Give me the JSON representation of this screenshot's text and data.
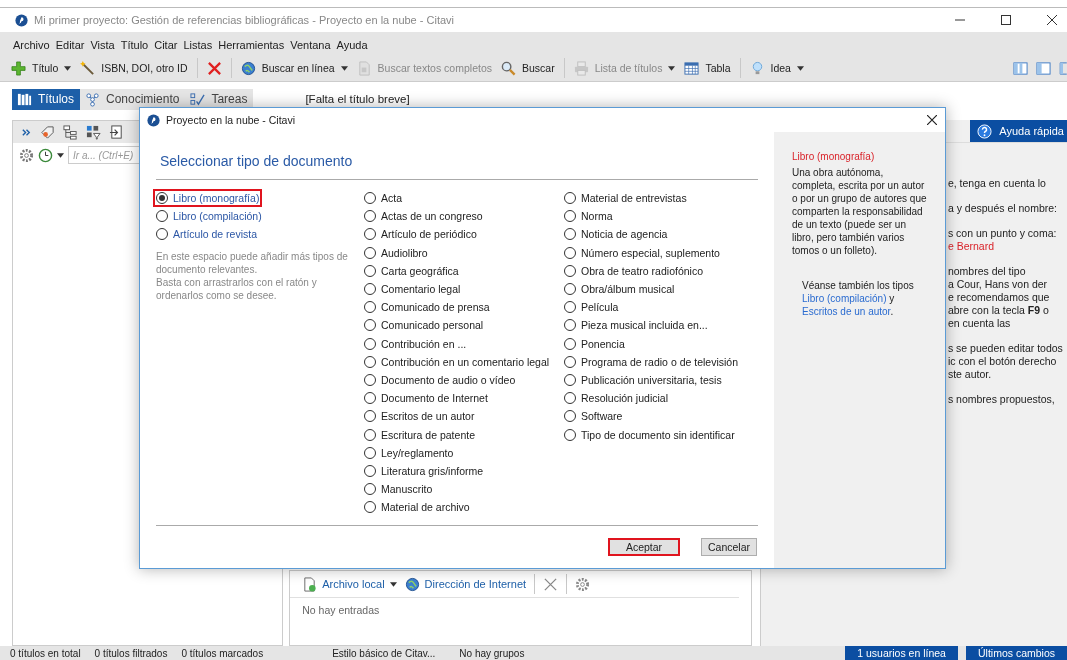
{
  "window": {
    "title": "Mi primer proyecto: Gestión de referencias bibliográficas - Proyecto en la nube - Citavi"
  },
  "menu": [
    "Archivo",
    "Editar",
    "Vista",
    "Título",
    "Citar",
    "Listas",
    "Herramientas",
    "Ventana",
    "Ayuda"
  ],
  "toolbar": [
    {
      "kind": "add",
      "label": "Título",
      "dropdown": true,
      "disabled": false
    },
    {
      "kind": "identifier",
      "label": "ISBN, DOI, otro ID",
      "dropdown": false,
      "disabled": false
    },
    {
      "kind": "separator"
    },
    {
      "kind": "delete",
      "dropdown": false,
      "disabled": false
    },
    {
      "kind": "separator"
    },
    {
      "kind": "online",
      "label": "Buscar en línea",
      "dropdown": true,
      "disabled": false
    },
    {
      "kind": "fulltext",
      "label": "Buscar textos completos",
      "dropdown": false,
      "disabled": true
    },
    {
      "kind": "search",
      "label": "Buscar",
      "dropdown": false,
      "disabled": false
    },
    {
      "kind": "separator"
    },
    {
      "kind": "print",
      "label": "Lista de títulos",
      "dropdown": true,
      "disabled": true
    },
    {
      "kind": "table",
      "label": "Tabla",
      "dropdown": false,
      "disabled": false
    },
    {
      "kind": "separator"
    },
    {
      "kind": "idea",
      "label": "Idea",
      "dropdown": true,
      "disabled": false
    }
  ],
  "tabs": [
    {
      "label": "Títulos",
      "selected": true
    },
    {
      "label": "Conocimiento",
      "selected": false
    },
    {
      "label": "Tareas",
      "selected": false
    }
  ],
  "short_title": "[Falta el título breve]",
  "left_panel": {
    "search": {
      "placeholder": "Ir a... (Ctrl+E)"
    }
  },
  "attachments": {
    "buttons": [
      {
        "label": "Archivo local",
        "dropdown": true
      },
      {
        "label": "Dirección de Internet",
        "dropdown": false
      }
    ],
    "empty": "No hay entradas"
  },
  "help_panel": {
    "button": "Ayuda rápida",
    "paragraphs": [
      [
        {
          "text": "e, tenga en cuenta lo",
          "kind": "text"
        }
      ],
      [
        {
          "text": "a y después el nombre:",
          "kind": "text"
        }
      ],
      [
        {
          "text": "s con un punto y coma:",
          "kind": "text"
        },
        {
          "text": "e Bernard",
          "kind": "name"
        }
      ],
      [
        {
          "text": "nombres del tipo",
          "kind": "text"
        },
        {
          "text": "a Cour, Hans von der",
          "kind": "text"
        },
        {
          "text": "e recomendamos que",
          "kind": "text"
        },
        {
          "text": "abre con la tecla **F9** o",
          "kind": "text"
        },
        {
          "text": "en cuenta las",
          "kind": "text"
        }
      ],
      [
        {
          "text": "s se pueden editar todos",
          "kind": "text"
        },
        {
          "text": "ic con el botón derecho",
          "kind": "text"
        },
        {
          "text": "ste autor.",
          "kind": "text"
        }
      ],
      [
        {
          "text": "s nombres propuestos,",
          "kind": "text"
        }
      ]
    ]
  },
  "dialog": {
    "title": "Proyecto en la nube - Citavi",
    "heading": "Seleccionar tipo de documento",
    "favorites": [
      {
        "label": "Libro (monografía)",
        "selected": true,
        "highlighted": true
      },
      {
        "label": "Libro (compilación)",
        "selected": false,
        "highlighted": false
      },
      {
        "label": "Artículo de revista",
        "selected": false,
        "highlighted": false
      }
    ],
    "hint": [
      "En este espacio puede añadir más tipos de documento relevantes.",
      "Basta con arrastrarlos con el ratón y ordenarlos como se desee."
    ],
    "columns": [
      [
        {
          "label": "Acta",
          "selected": false
        },
        {
          "label": "Actas de un congreso",
          "selected": false
        },
        {
          "label": "Artículo de periódico",
          "selected": false
        },
        {
          "label": "Audiolibro",
          "selected": false
        },
        {
          "label": "Carta geográfica",
          "selected": false
        },
        {
          "label": "Comentario legal",
          "selected": false
        },
        {
          "label": "Comunicado de prensa",
          "selected": false
        },
        {
          "label": "Comunicado personal",
          "selected": false
        },
        {
          "label": "Contribución en ...",
          "selected": false
        },
        {
          "label": "Contribución en un comentario legal",
          "selected": false
        },
        {
          "label": "Documento de audio o vídeo",
          "selected": false
        },
        {
          "label": "Documento de Internet",
          "selected": false
        },
        {
          "label": "Escritos de un autor",
          "selected": false
        },
        {
          "label": "Escritura de patente",
          "selected": false
        },
        {
          "label": "Ley/reglamento",
          "selected": false
        },
        {
          "label": "Literatura gris/informe",
          "selected": false
        },
        {
          "label": "Manuscrito",
          "selected": false
        },
        {
          "label": "Material de archivo",
          "selected": false
        }
      ],
      [
        {
          "label": "Material de entrevistas",
          "selected": false
        },
        {
          "label": "Norma",
          "selected": false
        },
        {
          "label": "Noticia de agencia",
          "selected": false
        },
        {
          "label": "Número especial, suplemento",
          "selected": false
        },
        {
          "label": "Obra de teatro radiofónico",
          "selected": false
        },
        {
          "label": "Obra/álbum musical",
          "selected": false
        },
        {
          "label": "Película",
          "selected": false
        },
        {
          "label": "Pieza musical incluida en...",
          "selected": false
        },
        {
          "label": "Ponencia",
          "selected": false
        },
        {
          "label": "Programa de radio o de televisión",
          "selected": false
        },
        {
          "label": "Publicación universitaria, tesis",
          "selected": false
        },
        {
          "label": "Resolución judicial",
          "selected": false
        },
        {
          "label": "Software",
          "selected": false
        },
        {
          "label": "Tipo de documento sin identificar",
          "selected": false
        }
      ]
    ],
    "info": {
      "title": "Libro (monografía)",
      "description": "Una obra autónoma, completa, escrita por un autor o por un grupo de autores que comparten la responsabilidad de un texto (puede ser un libro, pero también varios tomos o un folleto).",
      "see_also": [
        {
          "text": "Véanse también los tipos ",
          "kind": "text"
        },
        {
          "text": "Libro (compilación)",
          "kind": "link"
        },
        {
          "text": " y ",
          "kind": "text"
        },
        {
          "text": "Escritos de un autor",
          "kind": "link"
        },
        {
          "text": ".",
          "kind": "text"
        }
      ]
    },
    "buttons": [
      {
        "label": "Aceptar",
        "highlighted": true
      },
      {
        "label": "Cancelar",
        "highlighted": false
      }
    ]
  },
  "status_bar": {
    "items": [
      "0 títulos en total",
      "0 títulos filtrados",
      "0 títulos marcados",
      "Estilo básico de Citav...",
      "No hay grupos"
    ],
    "buttons": [
      "1 usuarios en línea",
      "Últimos cambios"
    ]
  }
}
